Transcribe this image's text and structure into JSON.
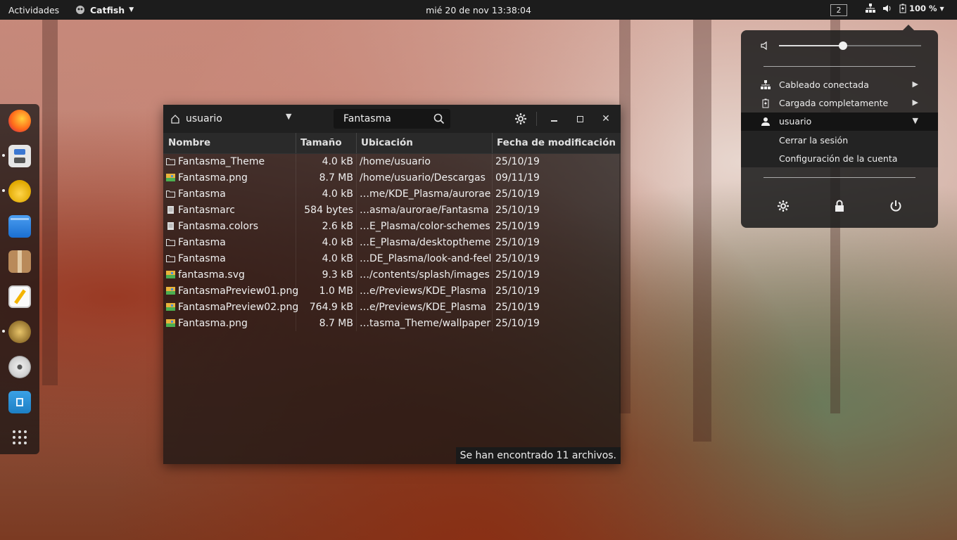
{
  "topbar": {
    "activities": "Actividades",
    "app_name": "Catfish",
    "clock": "mié 20 de nov  13:38:04",
    "workspace": "2",
    "battery": "100 %"
  },
  "dock": {
    "items": [
      "firefox-icon",
      "settings-app-icon",
      "teapot-icon",
      "files-icon",
      "archive-icon",
      "text-editor-icon",
      "catfish-icon",
      "disc-icon",
      "trash-folder-icon",
      "app-grid-icon"
    ]
  },
  "window": {
    "location": "usuario",
    "search_query": "Fantasma",
    "columns": [
      "Nombre",
      "Tamaño",
      "Ubicación",
      "Fecha de modificación"
    ],
    "rows": [
      {
        "name": "Fantasma_Theme",
        "size": "4.0 kB",
        "location": "/home/usuario",
        "date": "25/10/19",
        "type": "folder"
      },
      {
        "name": "Fantasma.png",
        "size": "8.7 MB",
        "location": "/home/usuario/Descargas",
        "date": "09/11/19",
        "type": "image"
      },
      {
        "name": "Fantasma",
        "size": "4.0 kB",
        "location": "…me/KDE_Plasma/aurorae",
        "date": "25/10/19",
        "type": "folder"
      },
      {
        "name": "Fantasmarc",
        "size": "584 bytes",
        "location": "…asma/aurorae/Fantasma",
        "date": "25/10/19",
        "type": "file"
      },
      {
        "name": "Fantasma.colors",
        "size": "2.6 kB",
        "location": "…E_Plasma/color-schemes",
        "date": "25/10/19",
        "type": "file"
      },
      {
        "name": "Fantasma",
        "size": "4.0 kB",
        "location": "…E_Plasma/desktoptheme",
        "date": "25/10/19",
        "type": "folder"
      },
      {
        "name": "Fantasma",
        "size": "4.0 kB",
        "location": "…DE_Plasma/look-and-feel",
        "date": "25/10/19",
        "type": "folder"
      },
      {
        "name": "fantasma.svg",
        "size": "9.3 kB",
        "location": "…/contents/splash/images",
        "date": "25/10/19",
        "type": "image"
      },
      {
        "name": "FantasmaPreview01.png",
        "size": "1.0 MB",
        "location": "…e/Previews/KDE_Plasma",
        "date": "25/10/19",
        "type": "image"
      },
      {
        "name": "FantasmaPreview02.png",
        "size": "764.9 kB",
        "location": "…e/Previews/KDE_Plasma",
        "date": "25/10/19",
        "type": "image"
      },
      {
        "name": "Fantasma.png",
        "size": "8.7 MB",
        "location": "…tasma_Theme/wallpaper",
        "date": "25/10/19",
        "type": "image"
      }
    ],
    "status": "Se han encontrado 11 archivos."
  },
  "system_menu": {
    "volume_level": 0.45,
    "wired": "Cableado conectada",
    "battery": "Cargada completamente",
    "user": "usuario",
    "logout": "Cerrar la sesión",
    "account_settings": "Configuración de la cuenta"
  }
}
